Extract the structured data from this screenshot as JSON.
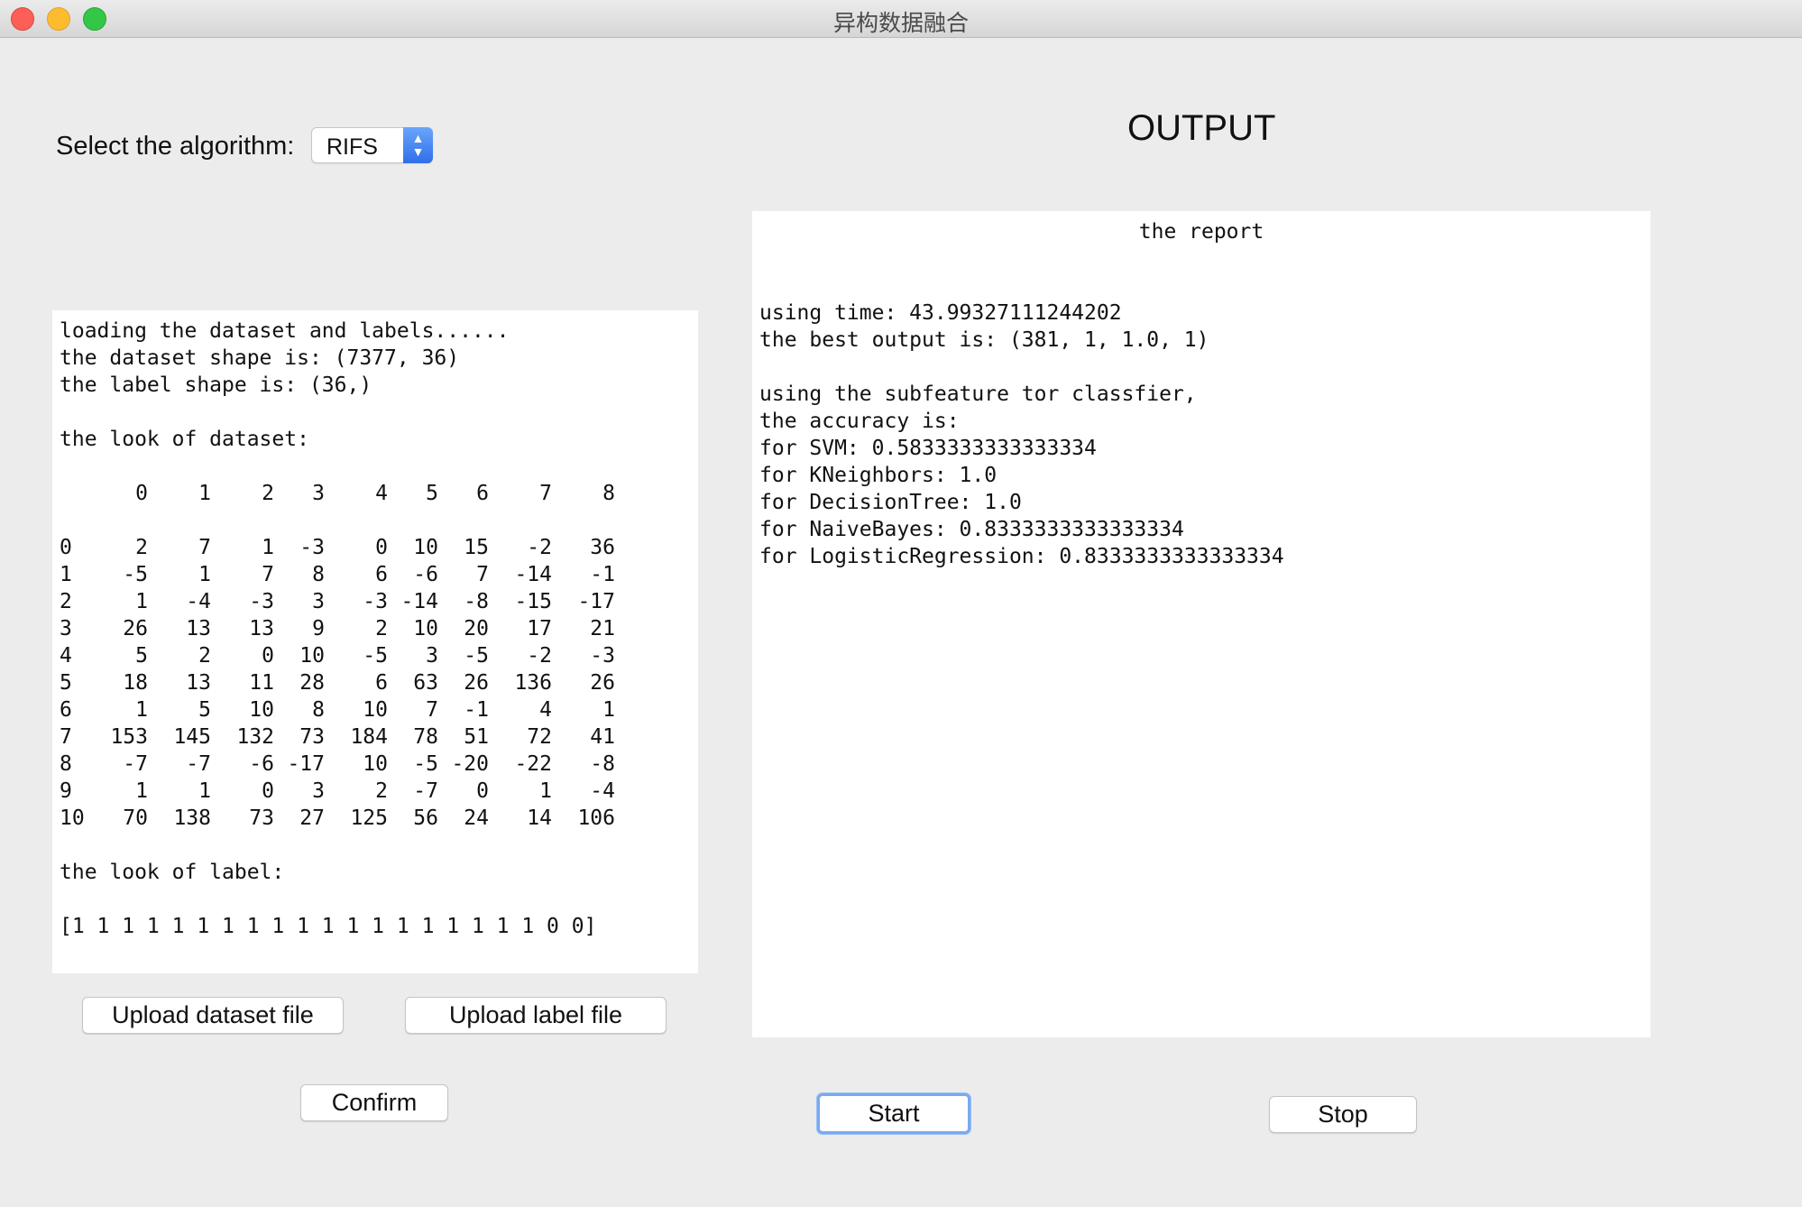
{
  "window": {
    "title": "异构数据融合"
  },
  "algorithm": {
    "label": "Select the algorithm:",
    "selected": "RIFS"
  },
  "output_heading": "OUTPUT",
  "log": {
    "intro_lines": [
      "loading the dataset and labels......",
      "the dataset shape is: (7377, 36)",
      "the label shape is: (36,)",
      "",
      "the look of dataset:"
    ],
    "columns": [
      "0",
      "1",
      "2",
      "3",
      "4",
      "5",
      "6",
      "7",
      "8"
    ],
    "rows": [
      [
        "0",
        "2",
        "7",
        "1",
        "-3",
        "0",
        "10",
        "15",
        "-2",
        "36"
      ],
      [
        "1",
        "-5",
        "1",
        "7",
        "8",
        "6",
        "-6",
        "7",
        "-14",
        "-1"
      ],
      [
        "2",
        "1",
        "-4",
        "-3",
        "3",
        "-3",
        "-14",
        "-8",
        "-15",
        "-17"
      ],
      [
        "3",
        "26",
        "13",
        "13",
        "9",
        "2",
        "10",
        "20",
        "17",
        "21"
      ],
      [
        "4",
        "5",
        "2",
        "0",
        "10",
        "-5",
        "3",
        "-5",
        "-2",
        "-3"
      ],
      [
        "5",
        "18",
        "13",
        "11",
        "28",
        "6",
        "63",
        "26",
        "136",
        "26"
      ],
      [
        "6",
        "1",
        "5",
        "10",
        "8",
        "10",
        "7",
        "-1",
        "4",
        "1"
      ],
      [
        "7",
        "153",
        "145",
        "132",
        "73",
        "184",
        "78",
        "51",
        "72",
        "41"
      ],
      [
        "8",
        "-7",
        "-7",
        "-6",
        "-17",
        "10",
        "-5",
        "-20",
        "-22",
        "-8"
      ],
      [
        "9",
        "1",
        "1",
        "0",
        "3",
        "2",
        "-7",
        "0",
        "1",
        "-4"
      ],
      [
        "10",
        "70",
        "138",
        "73",
        "27",
        "125",
        "56",
        "24",
        "14",
        "106"
      ]
    ],
    "label_heading": "the look of label:",
    "label_values": "[1 1 1 1 1 1 1 1 1 1 1 1 1 1 1 1 1 1 1 0 0]"
  },
  "report": {
    "title": "the report",
    "lines": [
      "using time: 43.99327111244202",
      "the best output is: (381, 1, 1.0, 1)",
      "",
      "using the subfeature tor classfier,",
      "the accuracy is:",
      "for SVM: 0.5833333333333334",
      "for KNeighbors: 1.0",
      "for DecisionTree: 1.0",
      "for NaiveBayes: 0.8333333333333334",
      "for LogisticRegression: 0.8333333333333334"
    ]
  },
  "buttons": {
    "upload_dataset": "Upload dataset file",
    "upload_label": "Upload label file",
    "confirm": "Confirm",
    "start": "Start",
    "stop": "Stop"
  },
  "colors": {
    "window_bg": "#ececec",
    "accent": "#3a7cf0"
  }
}
